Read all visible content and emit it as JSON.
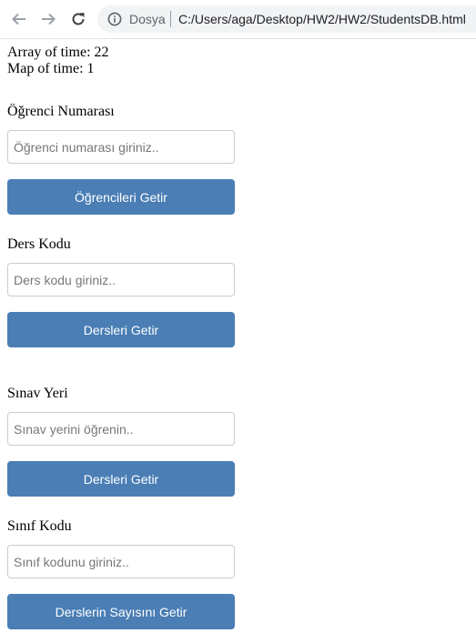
{
  "browser": {
    "scheme_label": "Dosya",
    "url": "C:/Users/aga/Desktop/HW2/HW2/StudentsDB.html",
    "icons": {
      "back": "back-arrow-icon",
      "forward": "forward-arrow-icon",
      "reload": "reload-icon",
      "info": "info-icon"
    }
  },
  "timings": {
    "array_line": "Array of time: 22",
    "map_line": "Map of time: 1"
  },
  "sections": [
    {
      "label": "Öğrenci Numarası",
      "placeholder": "Öğrenci numarası giriniz..",
      "value": "",
      "button": "Öğrencileri Getir"
    },
    {
      "label": "Ders Kodu",
      "placeholder": "Ders kodu giriniz..",
      "value": "",
      "button": "Dersleri Getir"
    },
    {
      "label": "Sınav Yeri",
      "placeholder": "Sınav yerini öğrenin..",
      "value": "",
      "button": "Dersleri Getir"
    },
    {
      "label": "Sınıf Kodu",
      "placeholder": "Sınıf kodunu giriniz..",
      "value": "",
      "button": "Derslerin Sayısını Getir"
    }
  ],
  "colors": {
    "button_bg": "#4a7eb5",
    "button_text": "#ffffff",
    "input_border": "#cccccc"
  }
}
